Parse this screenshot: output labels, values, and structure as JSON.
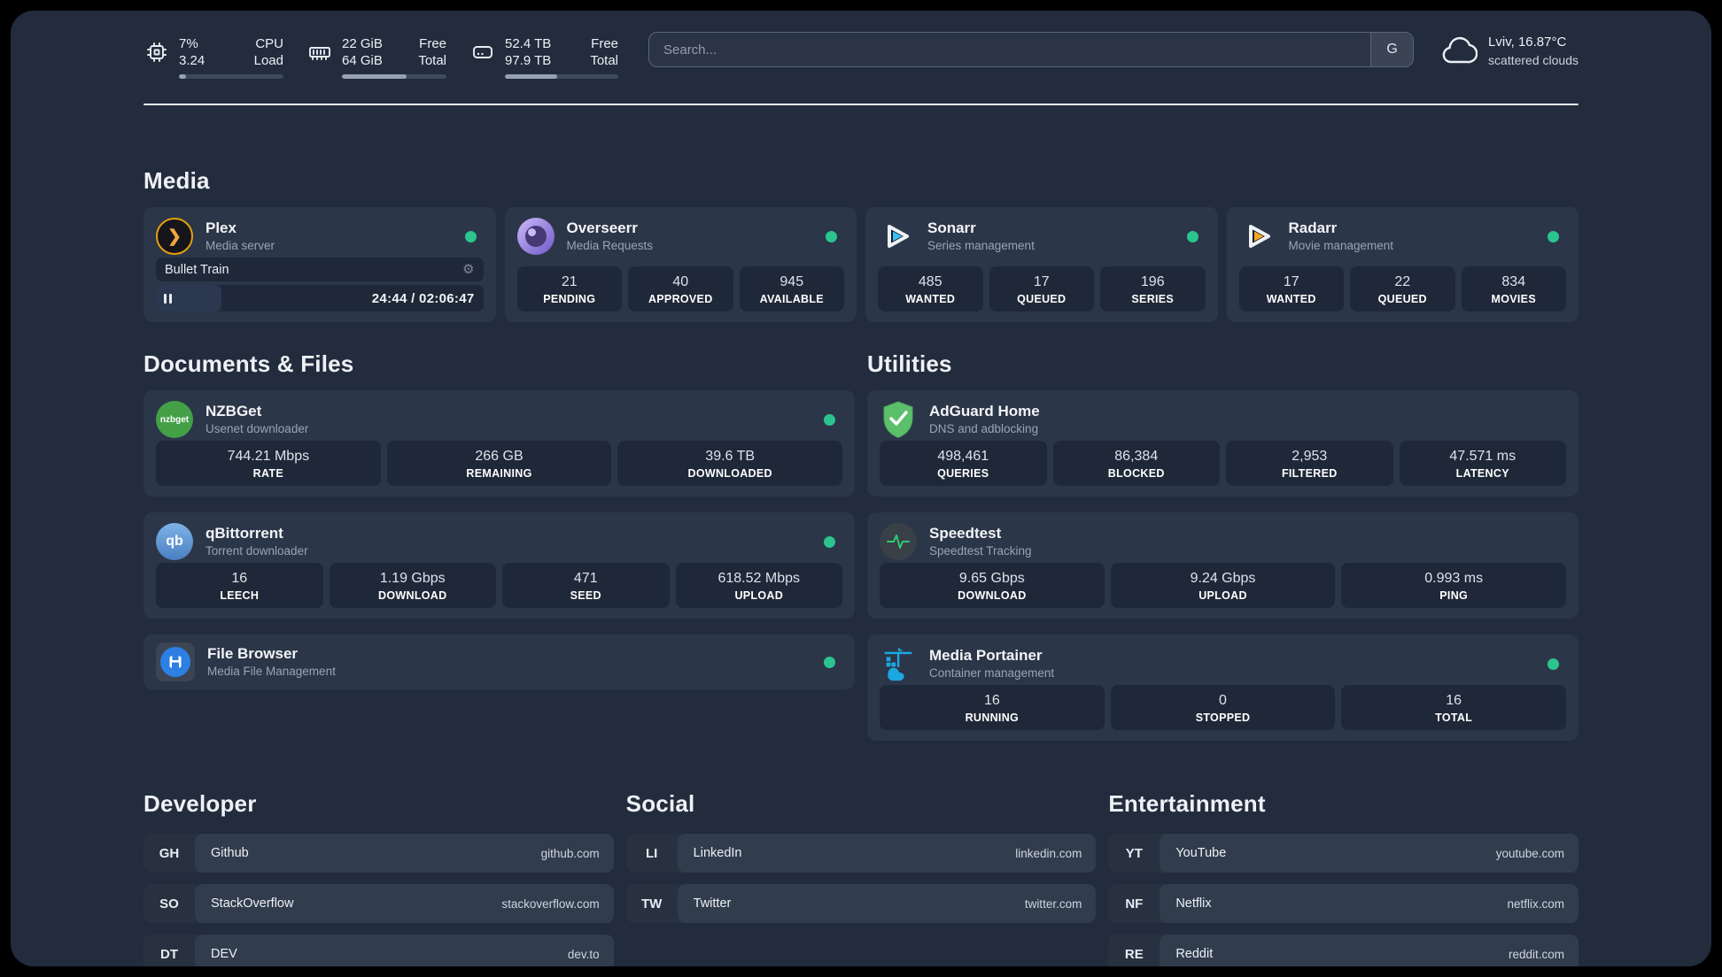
{
  "colors": {
    "status_online": "#2bc48f",
    "plex": "#e5a00d",
    "overseerr": "#6f59c9",
    "sonarr_triangle": "#38c1f1",
    "radarr_triangle": "#f9a825",
    "nzbget": "#43a047",
    "qbittorrent": "#5c9ce6",
    "adguard": "#5bbf6b",
    "speedtest_pulse": "#2ecc71",
    "portainer": "#1ba8e0"
  },
  "header": {
    "stats": [
      {
        "icon": "cpu-icon",
        "v1": "7%",
        "v2": "3.24",
        "l1": "CPU",
        "l2": "Load",
        "progress": 7
      },
      {
        "icon": "ram-icon",
        "v1": "22 GiB",
        "v2": "64 GiB",
        "l1": "Free",
        "l2": "Total",
        "progress": 62
      },
      {
        "icon": "disk-icon",
        "v1": "52.4 TB",
        "v2": "97.9 TB",
        "l1": "Free",
        "l2": "Total",
        "progress": 46
      }
    ],
    "search": {
      "placeholder": "Search...",
      "button": "G"
    },
    "weather": {
      "line1": "Lviv, 16.87°C",
      "line2": "scattered clouds"
    }
  },
  "sections": {
    "media": {
      "title": "Media",
      "apps": [
        {
          "name": "Plex",
          "subtitle": "Media server",
          "online": true,
          "player": {
            "title": "Bullet Train",
            "time": "24:44 / 02:06:47",
            "progress": 20
          }
        },
        {
          "name": "Overseerr",
          "subtitle": "Media Requests",
          "online": true,
          "stats": [
            {
              "value": "21",
              "label": "PENDING"
            },
            {
              "value": "40",
              "label": "APPROVED"
            },
            {
              "value": "945",
              "label": "AVAILABLE"
            }
          ]
        },
        {
          "name": "Sonarr",
          "subtitle": "Series management",
          "online": true,
          "stats": [
            {
              "value": "485",
              "label": "WANTED"
            },
            {
              "value": "17",
              "label": "QUEUED"
            },
            {
              "value": "196",
              "label": "SERIES"
            }
          ]
        },
        {
          "name": "Radarr",
          "subtitle": "Movie management",
          "online": true,
          "stats": [
            {
              "value": "17",
              "label": "WANTED"
            },
            {
              "value": "22",
              "label": "QUEUED"
            },
            {
              "value": "834",
              "label": "MOVIES"
            }
          ]
        }
      ]
    },
    "documents": {
      "title": "Documents & Files",
      "apps": [
        {
          "name": "NZBGet",
          "subtitle": "Usenet downloader",
          "online": true,
          "logo_text": "nzbget",
          "stats": [
            {
              "value": "744.21 Mbps",
              "label": "RATE"
            },
            {
              "value": "266 GB",
              "label": "REMAINING"
            },
            {
              "value": "39.6 TB",
              "label": "DOWNLOADED"
            }
          ]
        },
        {
          "name": "qBittorrent",
          "subtitle": "Torrent downloader",
          "online": true,
          "logo_text": "qb",
          "stats": [
            {
              "value": "16",
              "label": "LEECH"
            },
            {
              "value": "1.19 Gbps",
              "label": "DOWNLOAD"
            },
            {
              "value": "471",
              "label": "SEED"
            },
            {
              "value": "618.52 Mbps",
              "label": "UPLOAD"
            }
          ]
        },
        {
          "name": "File Browser",
          "subtitle": "Media File Management",
          "online": true
        }
      ]
    },
    "utilities": {
      "title": "Utilities",
      "apps": [
        {
          "name": "AdGuard Home",
          "subtitle": "DNS and adblocking",
          "stats": [
            {
              "value": "498,461",
              "label": "QUERIES"
            },
            {
              "value": "86,384",
              "label": "BLOCKED"
            },
            {
              "value": "2,953",
              "label": "FILTERED"
            },
            {
              "value": "47.571 ms",
              "label": "LATENCY"
            }
          ]
        },
        {
          "name": "Speedtest",
          "subtitle": "Speedtest Tracking",
          "stats": [
            {
              "value": "9.65 Gbps",
              "label": "DOWNLOAD"
            },
            {
              "value": "9.24 Gbps",
              "label": "UPLOAD"
            },
            {
              "value": "0.993 ms",
              "label": "PING"
            }
          ]
        },
        {
          "name": "Media Portainer",
          "subtitle": "Container management",
          "online": true,
          "stats": [
            {
              "value": "16",
              "label": "RUNNING"
            },
            {
              "value": "0",
              "label": "STOPPED"
            },
            {
              "value": "16",
              "label": "TOTAL"
            }
          ]
        }
      ]
    }
  },
  "bookmarks": [
    {
      "title": "Developer",
      "items": [
        {
          "abbr": "GH",
          "name": "Github",
          "url": "github.com"
        },
        {
          "abbr": "SO",
          "name": "StackOverflow",
          "url": "stackoverflow.com"
        },
        {
          "abbr": "DT",
          "name": "DEV",
          "url": "dev.to"
        }
      ]
    },
    {
      "title": "Social",
      "items": [
        {
          "abbr": "LI",
          "name": "LinkedIn",
          "url": "linkedin.com"
        },
        {
          "abbr": "TW",
          "name": "Twitter",
          "url": "twitter.com"
        }
      ]
    },
    {
      "title": "Entertainment",
      "items": [
        {
          "abbr": "YT",
          "name": "YouTube",
          "url": "youtube.com"
        },
        {
          "abbr": "NF",
          "name": "Netflix",
          "url": "netflix.com"
        },
        {
          "abbr": "RE",
          "name": "Reddit",
          "url": "reddit.com"
        }
      ]
    }
  ]
}
